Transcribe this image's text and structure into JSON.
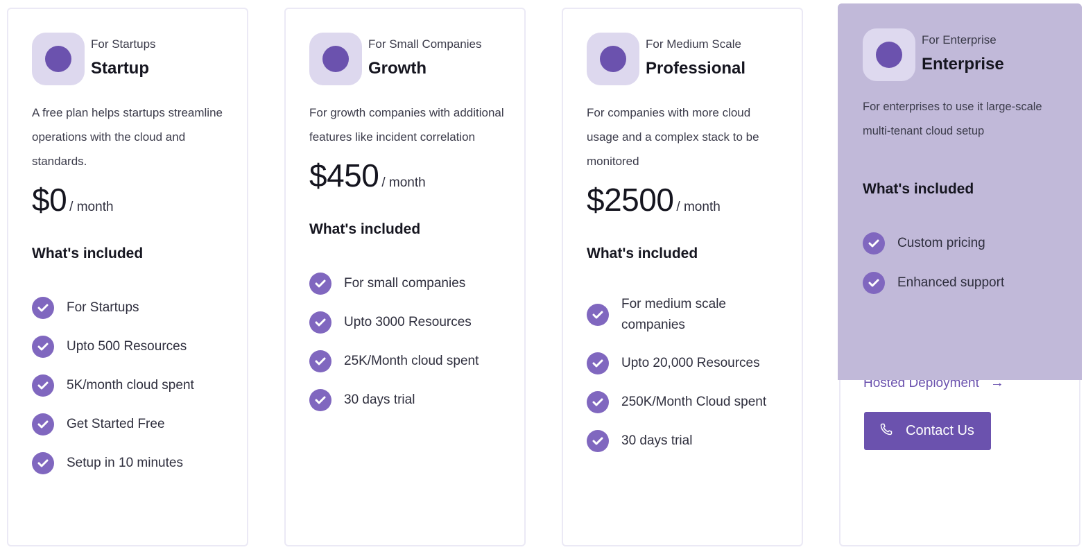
{
  "colors": {
    "accent": "#6b52ae",
    "check": "#8067bf",
    "icon_bg": "#ddd8ee",
    "highlight_overlay": "#c1b9d9",
    "card_border": "#ebe9f5"
  },
  "included_heading": "What's included",
  "plans": [
    {
      "tagline": "For Startups",
      "name": "Startup",
      "description": "A free plan helps startups streamline operations with the cloud and standards.",
      "price": "$0",
      "period": "/ month",
      "features": [
        "For Startups",
        "Upto 500 Resources",
        "5K/month cloud spent",
        "Get Started Free",
        "Setup in 10 minutes"
      ]
    },
    {
      "tagline": "For Small Companies",
      "name": "Growth",
      "description": "For growth companies with additional features like incident correlation",
      "price": "$450",
      "period": "/ month",
      "features": [
        "For small companies",
        "Upto 3000 Resources",
        "25K/Month cloud spent",
        "30 days trial"
      ]
    },
    {
      "tagline": "For Medium Scale",
      "name": "Professional",
      "description": "For companies with more cloud usage and a complex stack to be monitored",
      "price": "$2500",
      "period": "/ month",
      "features": [
        "For medium scale companies",
        "Upto 20,000 Resources",
        "250K/Month Cloud spent",
        "30 days trial"
      ]
    },
    {
      "tagline": "For Enterprise",
      "name": "Enterprise",
      "description": "For enterprises to use it large-scale multi-tenant cloud setup",
      "features": [
        "Custom pricing",
        "Enhanced support"
      ],
      "hosted_link": "Hosted Deployment",
      "hosted_link_icon": "arrow-right-icon",
      "contact_button": "Contact Us",
      "contact_button_icon": "phone-icon"
    }
  ]
}
